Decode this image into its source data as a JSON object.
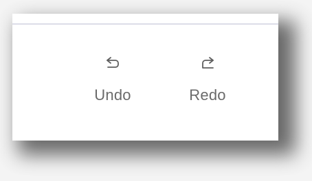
{
  "toolbar": {
    "undo": {
      "label": "Undo",
      "icon": "undo-icon"
    },
    "redo": {
      "label": "Redo",
      "icon": "redo-icon"
    }
  },
  "colors": {
    "panel_background": "#ffffff",
    "divider": "#dcdde8",
    "label_text": "#6a6a6a",
    "icon_stroke": "#5f5f5f"
  }
}
